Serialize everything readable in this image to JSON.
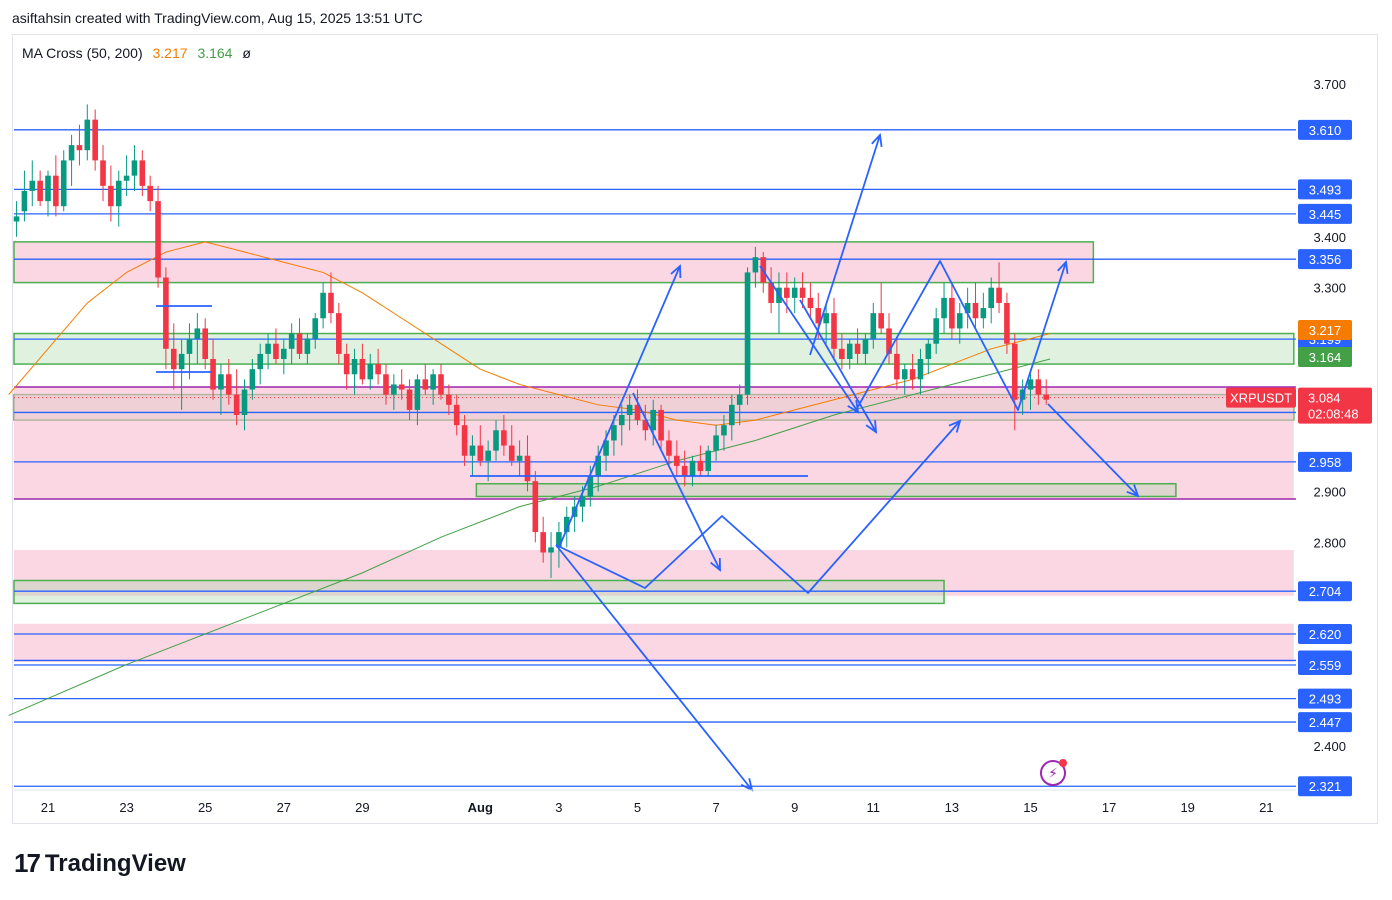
{
  "header": {
    "attribution": "asiftahsin created with TradingView.com, Aug 15, 2025 13:51 UTC"
  },
  "indicator": {
    "name": "MA Cross (50, 200)",
    "ma50_value": "3.217",
    "ma200_value": "3.164",
    "visibility_icon": "eye-crossed-icon"
  },
  "branding": {
    "logo_mark": "17",
    "logo_text": "TradingView"
  },
  "chart_data": {
    "type": "candlestick",
    "symbol": "XRPUSDT",
    "current_price": "3.084",
    "countdown": "02:08:48",
    "ylim": [
      2.31,
      3.8
    ],
    "y_ticks": [
      "3.700",
      "3.400",
      "3.300",
      "2.900",
      "2.800",
      "2.400"
    ],
    "x_ticks": [
      {
        "label": "21",
        "day": 0
      },
      {
        "label": "23",
        "day": 2
      },
      {
        "label": "25",
        "day": 4
      },
      {
        "label": "27",
        "day": 6
      },
      {
        "label": "29",
        "day": 8
      },
      {
        "label": "Aug",
        "day": 11
      },
      {
        "label": "3",
        "day": 13
      },
      {
        "label": "5",
        "day": 15
      },
      {
        "label": "7",
        "day": 17
      },
      {
        "label": "9",
        "day": 19
      },
      {
        "label": "11",
        "day": 21
      },
      {
        "label": "13",
        "day": 23
      },
      {
        "label": "15",
        "day": 25
      },
      {
        "label": "17",
        "day": 27
      },
      {
        "label": "19",
        "day": 29
      },
      {
        "label": "21",
        "day": 31
      }
    ],
    "horizontal_levels": [
      {
        "label": "3.610",
        "value": 3.61
      },
      {
        "label": "3.493",
        "value": 3.493
      },
      {
        "label": "3.445",
        "value": 3.445
      },
      {
        "label": "3.356",
        "value": 3.356
      },
      {
        "label": "3.199",
        "value": 3.199
      },
      {
        "label": "3.055",
        "value": 3.055
      },
      {
        "label": "2.958",
        "value": 2.958
      },
      {
        "label": "2.704",
        "value": 2.704
      },
      {
        "label": "2.620",
        "value": 2.62
      },
      {
        "label": "2.568",
        "value": 2.568
      },
      {
        "label": "2.559",
        "value": 2.559
      },
      {
        "label": "2.493",
        "value": 2.493
      },
      {
        "label": "2.447",
        "value": 2.447
      },
      {
        "label": "2.321",
        "value": 2.321
      }
    ],
    "ma_labels": [
      {
        "label": "3.217",
        "value": 3.217,
        "color": "#f57c00"
      },
      {
        "label": "3.164",
        "value": 3.164,
        "color": "#43a047"
      }
    ],
    "zones": [
      {
        "from_day": -1,
        "to_day": 26.6,
        "low": 3.31,
        "high": 3.39,
        "kind": "pink-green"
      },
      {
        "from_day": -1,
        "to_day": 31.7,
        "low": 3.15,
        "high": 3.21,
        "kind": "green"
      },
      {
        "from_day": -1,
        "to_day": 31.7,
        "low": 3.04,
        "high": 3.09,
        "kind": "green"
      },
      {
        "from_day": -1,
        "to_day": 31.7,
        "low": 2.885,
        "high": 3.105,
        "kind": "pink"
      },
      {
        "from_day": 10.9,
        "to_day": 28.7,
        "low": 2.89,
        "high": 2.915,
        "kind": "green"
      },
      {
        "from_day": -1,
        "to_day": 31.7,
        "low": 2.695,
        "high": 2.785,
        "kind": "pink"
      },
      {
        "from_day": -1,
        "to_day": 22.8,
        "low": 2.68,
        "high": 2.725,
        "kind": "green"
      },
      {
        "from_day": -1,
        "to_day": 31.7,
        "low": 2.565,
        "high": 2.64,
        "kind": "pink"
      }
    ],
    "purple_levels": [
      3.105,
      2.885
    ],
    "candles": [
      [
        -0.8,
        3.43,
        3.47,
        3.4,
        3.44
      ],
      [
        -0.6,
        3.45,
        3.53,
        3.43,
        3.49
      ],
      [
        -0.4,
        3.49,
        3.55,
        3.46,
        3.51
      ],
      [
        -0.2,
        3.51,
        3.53,
        3.46,
        3.47
      ],
      [
        0.0,
        3.47,
        3.53,
        3.44,
        3.52
      ],
      [
        0.2,
        3.52,
        3.56,
        3.44,
        3.46
      ],
      [
        0.4,
        3.46,
        3.57,
        3.45,
        3.55
      ],
      [
        0.6,
        3.55,
        3.6,
        3.5,
        3.58
      ],
      [
        0.8,
        3.58,
        3.62,
        3.54,
        3.57
      ],
      [
        1.0,
        3.57,
        3.66,
        3.55,
        3.63
      ],
      [
        1.2,
        3.63,
        3.65,
        3.53,
        3.55
      ],
      [
        1.4,
        3.55,
        3.58,
        3.47,
        3.5
      ],
      [
        1.6,
        3.5,
        3.54,
        3.43,
        3.46
      ],
      [
        1.8,
        3.46,
        3.53,
        3.42,
        3.51
      ],
      [
        2.0,
        3.51,
        3.56,
        3.48,
        3.52
      ],
      [
        2.2,
        3.52,
        3.58,
        3.49,
        3.55
      ],
      [
        2.4,
        3.55,
        3.57,
        3.48,
        3.5
      ],
      [
        2.6,
        3.5,
        3.52,
        3.45,
        3.47
      ],
      [
        2.8,
        3.47,
        3.5,
        3.3,
        3.32
      ],
      [
        3.0,
        3.32,
        3.34,
        3.14,
        3.18
      ],
      [
        3.2,
        3.18,
        3.23,
        3.1,
        3.14
      ],
      [
        3.4,
        3.14,
        3.2,
        3.06,
        3.17
      ],
      [
        3.6,
        3.17,
        3.23,
        3.12,
        3.2
      ],
      [
        3.8,
        3.2,
        3.25,
        3.15,
        3.22
      ],
      [
        4.0,
        3.22,
        3.24,
        3.14,
        3.16
      ],
      [
        4.2,
        3.16,
        3.2,
        3.08,
        3.1
      ],
      [
        4.4,
        3.1,
        3.15,
        3.05,
        3.13
      ],
      [
        4.6,
        3.13,
        3.16,
        3.07,
        3.09
      ],
      [
        4.8,
        3.09,
        3.14,
        3.03,
        3.05
      ],
      [
        5.0,
        3.05,
        3.12,
        3.02,
        3.1
      ],
      [
        5.2,
        3.1,
        3.16,
        3.08,
        3.14
      ],
      [
        5.4,
        3.14,
        3.19,
        3.11,
        3.17
      ],
      [
        5.6,
        3.17,
        3.21,
        3.14,
        3.19
      ],
      [
        5.8,
        3.19,
        3.22,
        3.15,
        3.16
      ],
      [
        6.0,
        3.16,
        3.2,
        3.13,
        3.18
      ],
      [
        6.2,
        3.18,
        3.23,
        3.15,
        3.21
      ],
      [
        6.4,
        3.21,
        3.24,
        3.16,
        3.17
      ],
      [
        6.6,
        3.17,
        3.21,
        3.15,
        3.2
      ],
      [
        6.8,
        3.2,
        3.25,
        3.18,
        3.24
      ],
      [
        7.0,
        3.24,
        3.31,
        3.22,
        3.29
      ],
      [
        7.2,
        3.29,
        3.33,
        3.23,
        3.25
      ],
      [
        7.4,
        3.25,
        3.27,
        3.15,
        3.17
      ],
      [
        7.6,
        3.17,
        3.19,
        3.1,
        3.13
      ],
      [
        7.8,
        3.13,
        3.18,
        3.09,
        3.16
      ],
      [
        8.0,
        3.16,
        3.19,
        3.11,
        3.12
      ],
      [
        8.2,
        3.12,
        3.17,
        3.1,
        3.15
      ],
      [
        8.4,
        3.15,
        3.18,
        3.11,
        3.13
      ],
      [
        8.6,
        3.13,
        3.15,
        3.07,
        3.09
      ],
      [
        8.8,
        3.09,
        3.13,
        3.06,
        3.11
      ],
      [
        9.0,
        3.11,
        3.14,
        3.08,
        3.1
      ],
      [
        9.2,
        3.1,
        3.12,
        3.04,
        3.06
      ],
      [
        9.4,
        3.06,
        3.13,
        3.03,
        3.12
      ],
      [
        9.6,
        3.12,
        3.15,
        3.09,
        3.1
      ],
      [
        9.8,
        3.1,
        3.14,
        3.07,
        3.13
      ],
      [
        10.0,
        3.13,
        3.15,
        3.08,
        3.09
      ],
      [
        10.2,
        3.09,
        3.11,
        3.05,
        3.07
      ],
      [
        10.4,
        3.07,
        3.09,
        3.01,
        3.03
      ],
      [
        10.6,
        3.03,
        3.05,
        2.95,
        2.97
      ],
      [
        10.8,
        2.97,
        3.01,
        2.93,
        2.99
      ],
      [
        11.0,
        2.99,
        3.03,
        2.95,
        2.96
      ],
      [
        11.2,
        2.96,
        3.0,
        2.92,
        2.98
      ],
      [
        11.4,
        2.98,
        3.04,
        2.96,
        3.02
      ],
      [
        11.6,
        3.02,
        3.05,
        2.97,
        2.99
      ],
      [
        11.8,
        2.99,
        3.03,
        2.95,
        2.96
      ],
      [
        12.0,
        2.96,
        3.0,
        2.93,
        2.97
      ],
      [
        12.2,
        2.97,
        3.01,
        2.9,
        2.92
      ],
      [
        12.4,
        2.92,
        2.94,
        2.8,
        2.82
      ],
      [
        12.6,
        2.82,
        2.85,
        2.76,
        2.78
      ],
      [
        12.8,
        2.78,
        2.82,
        2.73,
        2.79
      ],
      [
        13.0,
        2.79,
        2.84,
        2.75,
        2.82
      ],
      [
        13.2,
        2.82,
        2.87,
        2.79,
        2.85
      ],
      [
        13.4,
        2.85,
        2.89,
        2.82,
        2.87
      ],
      [
        13.6,
        2.87,
        2.91,
        2.84,
        2.89
      ],
      [
        13.8,
        2.89,
        2.95,
        2.87,
        2.93
      ],
      [
        14.0,
        2.93,
        2.99,
        2.9,
        2.97
      ],
      [
        14.2,
        2.97,
        3.02,
        2.94,
        3.0
      ],
      [
        14.4,
        3.0,
        3.05,
        2.97,
        3.03
      ],
      [
        14.6,
        3.03,
        3.07,
        2.99,
        3.05
      ],
      [
        14.8,
        3.05,
        3.09,
        3.02,
        3.07
      ],
      [
        15.0,
        3.07,
        3.1,
        3.03,
        3.04
      ],
      [
        15.2,
        3.04,
        3.07,
        3.0,
        3.02
      ],
      [
        15.4,
        3.02,
        3.08,
        2.99,
        3.06
      ],
      [
        15.6,
        3.06,
        3.07,
        2.98,
        3.0
      ],
      [
        15.8,
        3.0,
        3.02,
        2.95,
        2.97
      ],
      [
        16.0,
        2.97,
        3.0,
        2.93,
        2.95
      ],
      [
        16.2,
        2.95,
        2.98,
        2.91,
        2.93
      ],
      [
        16.4,
        2.93,
        2.97,
        2.91,
        2.96
      ],
      [
        16.6,
        2.96,
        2.99,
        2.93,
        2.94
      ],
      [
        16.8,
        2.94,
        2.99,
        2.93,
        2.98
      ],
      [
        17.0,
        2.98,
        3.03,
        2.96,
        3.01
      ],
      [
        17.2,
        3.01,
        3.05,
        2.98,
        3.03
      ],
      [
        17.4,
        3.03,
        3.09,
        3.0,
        3.07
      ],
      [
        17.6,
        3.07,
        3.11,
        3.03,
        3.09
      ],
      [
        17.8,
        3.09,
        3.34,
        3.07,
        3.33
      ],
      [
        18.0,
        3.33,
        3.38,
        3.3,
        3.36
      ],
      [
        18.2,
        3.36,
        3.37,
        3.29,
        3.31
      ],
      [
        18.4,
        3.31,
        3.34,
        3.25,
        3.27
      ],
      [
        18.6,
        3.27,
        3.33,
        3.21,
        3.3
      ],
      [
        18.8,
        3.3,
        3.33,
        3.25,
        3.28
      ],
      [
        19.0,
        3.28,
        3.32,
        3.25,
        3.3
      ],
      [
        19.2,
        3.3,
        3.33,
        3.26,
        3.28
      ],
      [
        19.4,
        3.28,
        3.31,
        3.24,
        3.26
      ],
      [
        19.6,
        3.26,
        3.29,
        3.2,
        3.23
      ],
      [
        19.8,
        3.23,
        3.27,
        3.19,
        3.25
      ],
      [
        20.0,
        3.25,
        3.28,
        3.16,
        3.18
      ],
      [
        20.2,
        3.18,
        3.21,
        3.14,
        3.16
      ],
      [
        20.4,
        3.16,
        3.2,
        3.14,
        3.19
      ],
      [
        20.6,
        3.19,
        3.22,
        3.15,
        3.17
      ],
      [
        20.8,
        3.17,
        3.21,
        3.15,
        3.2
      ],
      [
        21.0,
        3.2,
        3.27,
        3.18,
        3.25
      ],
      [
        21.2,
        3.25,
        3.31,
        3.21,
        3.22
      ],
      [
        21.4,
        3.22,
        3.25,
        3.15,
        3.17
      ],
      [
        21.6,
        3.17,
        3.2,
        3.1,
        3.12
      ],
      [
        21.8,
        3.12,
        3.15,
        3.09,
        3.14
      ],
      [
        22.0,
        3.14,
        3.17,
        3.1,
        3.12
      ],
      [
        22.2,
        3.12,
        3.18,
        3.09,
        3.16
      ],
      [
        22.4,
        3.16,
        3.2,
        3.13,
        3.19
      ],
      [
        22.6,
        3.19,
        3.26,
        3.17,
        3.24
      ],
      [
        22.8,
        3.24,
        3.31,
        3.21,
        3.28
      ],
      [
        23.0,
        3.28,
        3.31,
        3.2,
        3.22
      ],
      [
        23.2,
        3.22,
        3.27,
        3.19,
        3.25
      ],
      [
        23.4,
        3.25,
        3.3,
        3.22,
        3.27
      ],
      [
        23.6,
        3.27,
        3.31,
        3.22,
        3.24
      ],
      [
        23.8,
        3.24,
        3.29,
        3.22,
        3.26
      ],
      [
        24.0,
        3.26,
        3.32,
        3.23,
        3.3
      ],
      [
        24.2,
        3.3,
        3.35,
        3.25,
        3.27
      ],
      [
        24.4,
        3.27,
        3.29,
        3.17,
        3.19
      ],
      [
        24.6,
        3.19,
        3.21,
        3.02,
        3.08
      ],
      [
        24.8,
        3.08,
        3.12,
        3.05,
        3.1
      ],
      [
        25.0,
        3.1,
        3.14,
        3.06,
        3.12
      ],
      [
        25.2,
        3.12,
        3.14,
        3.07,
        3.09
      ],
      [
        25.4,
        3.09,
        3.12,
        3.07,
        3.08
      ]
    ],
    "ma50_points": [
      [
        -1.0,
        3.09
      ],
      [
        0.0,
        3.18
      ],
      [
        1.0,
        3.27
      ],
      [
        2.0,
        3.33
      ],
      [
        3.0,
        3.37
      ],
      [
        4.0,
        3.39
      ],
      [
        5.0,
        3.37
      ],
      [
        6.0,
        3.35
      ],
      [
        7.0,
        3.33
      ],
      [
        8.0,
        3.29
      ],
      [
        9.0,
        3.24
      ],
      [
        10.0,
        3.19
      ],
      [
        11.0,
        3.14
      ],
      [
        12.0,
        3.11
      ],
      [
        13.0,
        3.09
      ],
      [
        14.0,
        3.07
      ],
      [
        15.0,
        3.06
      ],
      [
        16.0,
        3.04
      ],
      [
        17.0,
        3.03
      ],
      [
        18.0,
        3.04
      ],
      [
        19.0,
        3.06
      ],
      [
        20.0,
        3.08
      ],
      [
        21.0,
        3.1
      ],
      [
        22.0,
        3.12
      ],
      [
        23.0,
        3.15
      ],
      [
        24.0,
        3.18
      ],
      [
        25.0,
        3.2
      ],
      [
        25.5,
        3.21
      ]
    ],
    "ma200_points": [
      [
        -1.0,
        2.46
      ],
      [
        2.0,
        2.56
      ],
      [
        5.0,
        2.65
      ],
      [
        8.0,
        2.74
      ],
      [
        10.0,
        2.81
      ],
      [
        12.0,
        2.87
      ],
      [
        14.0,
        2.91
      ],
      [
        16.0,
        2.96
      ],
      [
        18.0,
        3.0
      ],
      [
        20.0,
        3.05
      ],
      [
        22.0,
        3.09
      ],
      [
        24.0,
        3.13
      ],
      [
        25.5,
        3.16
      ]
    ]
  }
}
